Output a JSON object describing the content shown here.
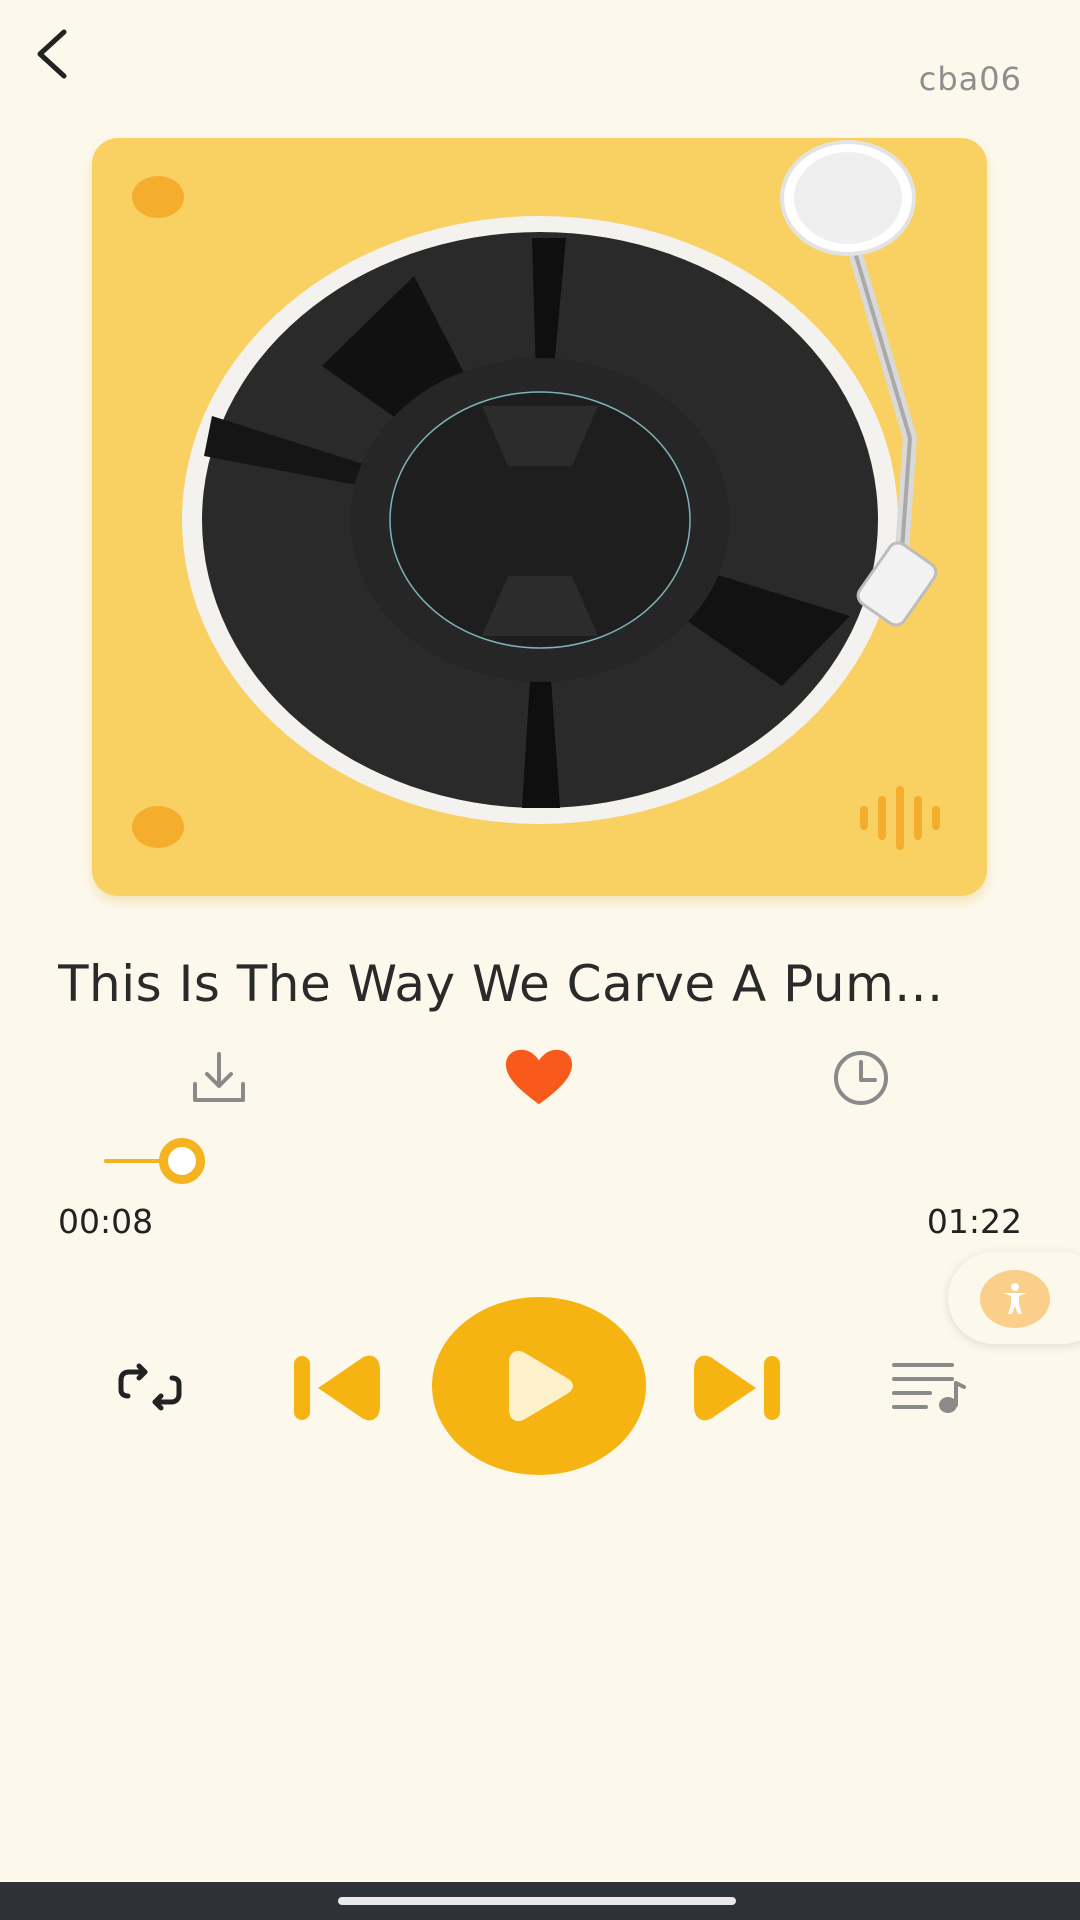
{
  "header": {
    "back_icon": "chevron-left-icon",
    "user_tag": "cba06"
  },
  "artwork": {
    "icons": [
      "turntable-illustration",
      "vinyl-record",
      "tonearm",
      "sound-wave-icon"
    ],
    "colors": {
      "deck": "#f9d062",
      "accent": "#f5ad2e"
    }
  },
  "track": {
    "title": "This Is The Way We Carve A Pum..."
  },
  "actions": {
    "download_icon": "download-icon",
    "favorite_icon": "heart-icon",
    "favorite_active": true,
    "timer_icon": "clock-icon"
  },
  "progress": {
    "current": "00:08",
    "total": "01:22",
    "fraction": 0.0976
  },
  "controls": {
    "repeat_icon": "repeat-icon",
    "previous_icon": "skip-previous-icon",
    "play_icon": "play-icon",
    "next_icon": "skip-next-icon",
    "playlist_icon": "playlist-icon"
  },
  "colors": {
    "background": "#fdf8ec",
    "primary": "#f5b411",
    "favorite": "#f75a1a"
  }
}
